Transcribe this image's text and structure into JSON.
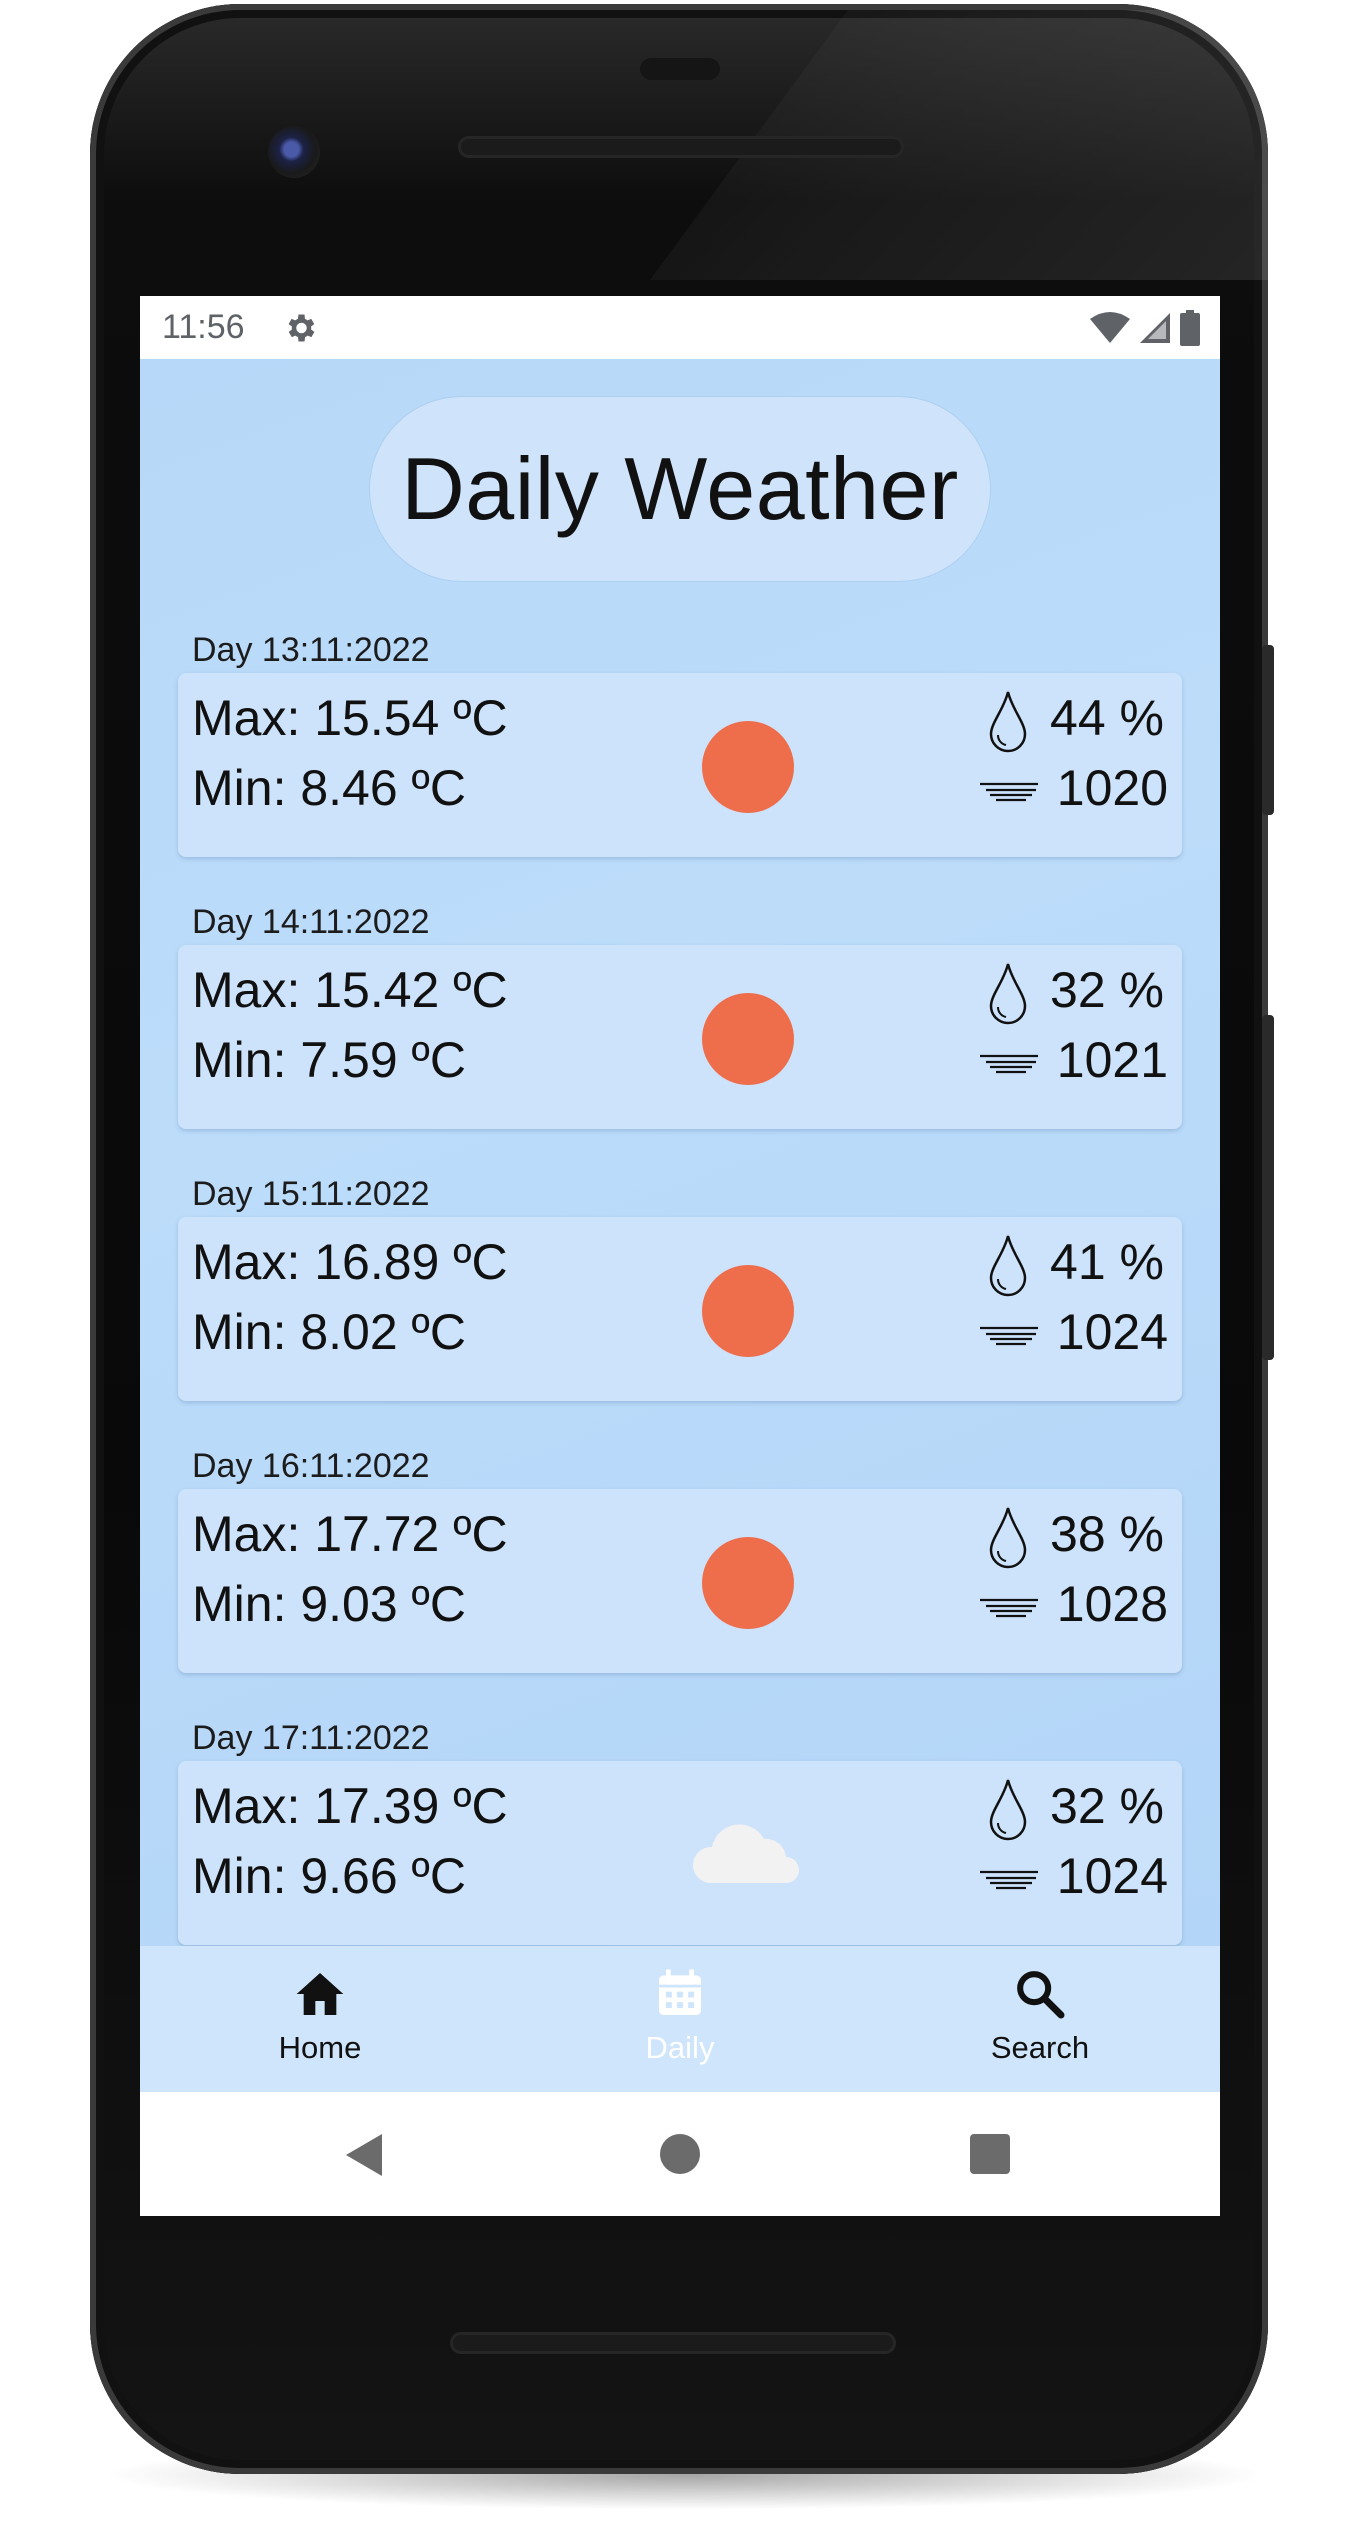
{
  "status_bar": {
    "time": "11:56",
    "icons": [
      "settings-gear-icon",
      "wifi-icon",
      "signal-icon",
      "battery-icon"
    ]
  },
  "header": {
    "title": "Daily Weather"
  },
  "colors": {
    "background": "#b9daf9",
    "card": "#cde3fb",
    "sun": "#ee6e4b",
    "cloud": "#f2f2f2",
    "active_nav": "#ffffff"
  },
  "days": [
    {
      "date": "Day 13:11:2022",
      "max": "Max: 15.54 ºC",
      "min": "Min: 8.46 ºC",
      "icon": "sun-icon",
      "humidity": "44 %",
      "pressure": "1020"
    },
    {
      "date": "Day 14:11:2022",
      "max": "Max: 15.42 ºC",
      "min": "Min: 7.59 ºC",
      "icon": "sun-icon",
      "humidity": "32 %",
      "pressure": "1021"
    },
    {
      "date": "Day 15:11:2022",
      "max": "Max: 16.89 ºC",
      "min": "Min: 8.02 ºC",
      "icon": "sun-icon",
      "humidity": "41 %",
      "pressure": "1024"
    },
    {
      "date": "Day 16:11:2022",
      "max": "Max: 17.72 ºC",
      "min": "Min: 9.03 ºC",
      "icon": "sun-icon",
      "humidity": "38 %",
      "pressure": "1028"
    },
    {
      "date": "Day 17:11:2022",
      "max": "Max: 17.39 ºC",
      "min": "Min: 9.66 ºC",
      "icon": "cloud-icon",
      "humidity": "32 %",
      "pressure": "1024"
    }
  ],
  "bottom_nav": {
    "items": [
      {
        "label": "Home",
        "icon": "home-icon"
      },
      {
        "label": "Daily",
        "icon": "calendar-icon",
        "active": true
      },
      {
        "label": "Search",
        "icon": "search-icon"
      }
    ]
  },
  "system_nav": {
    "icons": [
      "back-icon",
      "home-circle-icon",
      "recents-icon"
    ]
  }
}
